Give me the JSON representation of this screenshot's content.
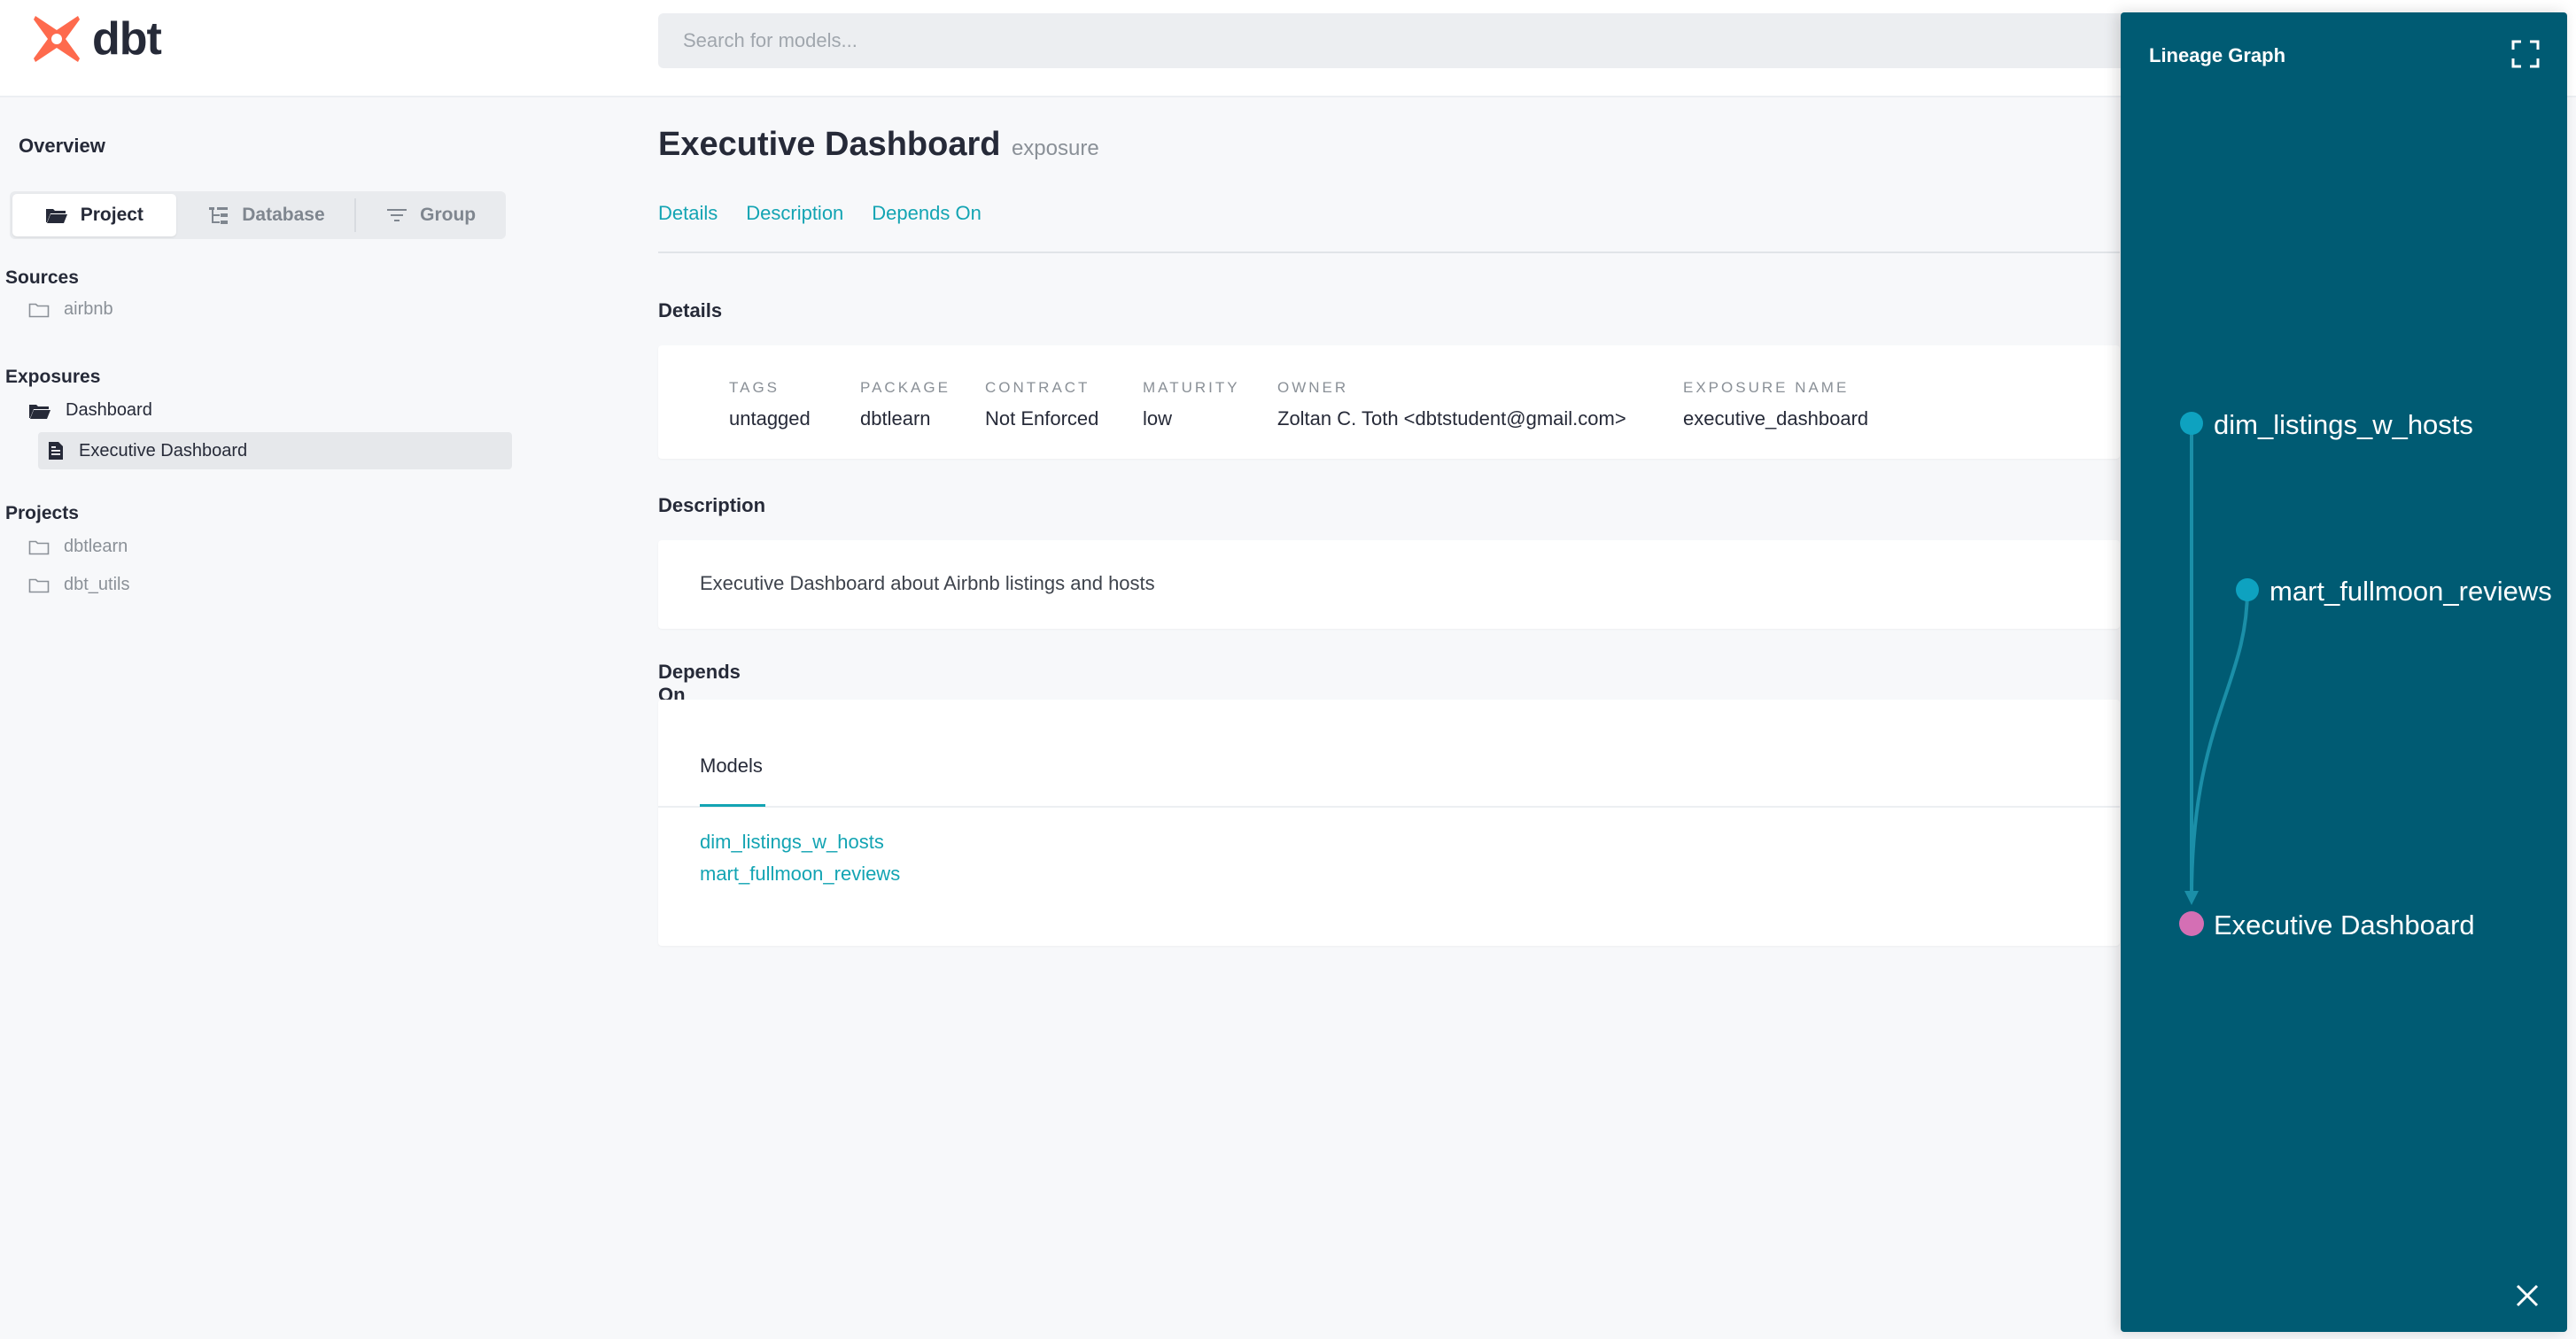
{
  "app": {
    "logo_text": "dbt",
    "brand_color": "#fe6a4d"
  },
  "search": {
    "placeholder": "Search for models..."
  },
  "sidebar": {
    "title": "Overview",
    "segments": [
      {
        "label": "Project",
        "icon": "folder-open-icon",
        "active": true
      },
      {
        "label": "Database",
        "icon": "tree-structure-icon",
        "active": false
      },
      {
        "label": "Group",
        "icon": "filter-lines-icon",
        "active": false
      }
    ],
    "sections": {
      "sources": {
        "title": "Sources",
        "items": [
          "airbnb"
        ]
      },
      "exposures": {
        "title": "Exposures",
        "folder": "Dashboard",
        "items": [
          "Executive Dashboard"
        ]
      },
      "projects": {
        "title": "Projects",
        "items": [
          "dbtlearn",
          "dbt_utils"
        ]
      }
    }
  },
  "main": {
    "title": "Executive Dashboard",
    "kind": "exposure",
    "tabs": [
      "Details",
      "Description",
      "Depends On"
    ],
    "details": {
      "heading": "Details",
      "fields": [
        {
          "label": "TAGS",
          "value": "untagged"
        },
        {
          "label": "PACKAGE",
          "value": "dbtlearn"
        },
        {
          "label": "CONTRACT",
          "value": "Not Enforced"
        },
        {
          "label": "MATURITY",
          "value": "low"
        },
        {
          "label": "OWNER",
          "value": "Zoltan C. Toth <dbtstudent@gmail.com>"
        },
        {
          "label": "EXPOSURE NAME",
          "value": "executive_dashboard"
        }
      ]
    },
    "description": {
      "heading": "Description",
      "text": "Executive Dashboard about Airbnb listings and hosts"
    },
    "depends_on": {
      "heading": "Depends On",
      "tab": "Models",
      "models": [
        "dim_listings_w_hosts",
        "mart_fullmoon_reviews"
      ]
    }
  },
  "lineage": {
    "title": "Lineage Graph",
    "background": "#005b73",
    "nodes": [
      {
        "label": "dim_listings_w_hosts",
        "type": "model",
        "color": "#0ea2c0"
      },
      {
        "label": "mart_fullmoon_reviews",
        "type": "model",
        "color": "#0ea2c0"
      },
      {
        "label": "Executive Dashboard",
        "type": "exposure",
        "color": "#d46fb4"
      }
    ],
    "edges": [
      [
        "dim_listings_w_hosts",
        "Executive Dashboard"
      ],
      [
        "mart_fullmoon_reviews",
        "Executive Dashboard"
      ]
    ]
  }
}
